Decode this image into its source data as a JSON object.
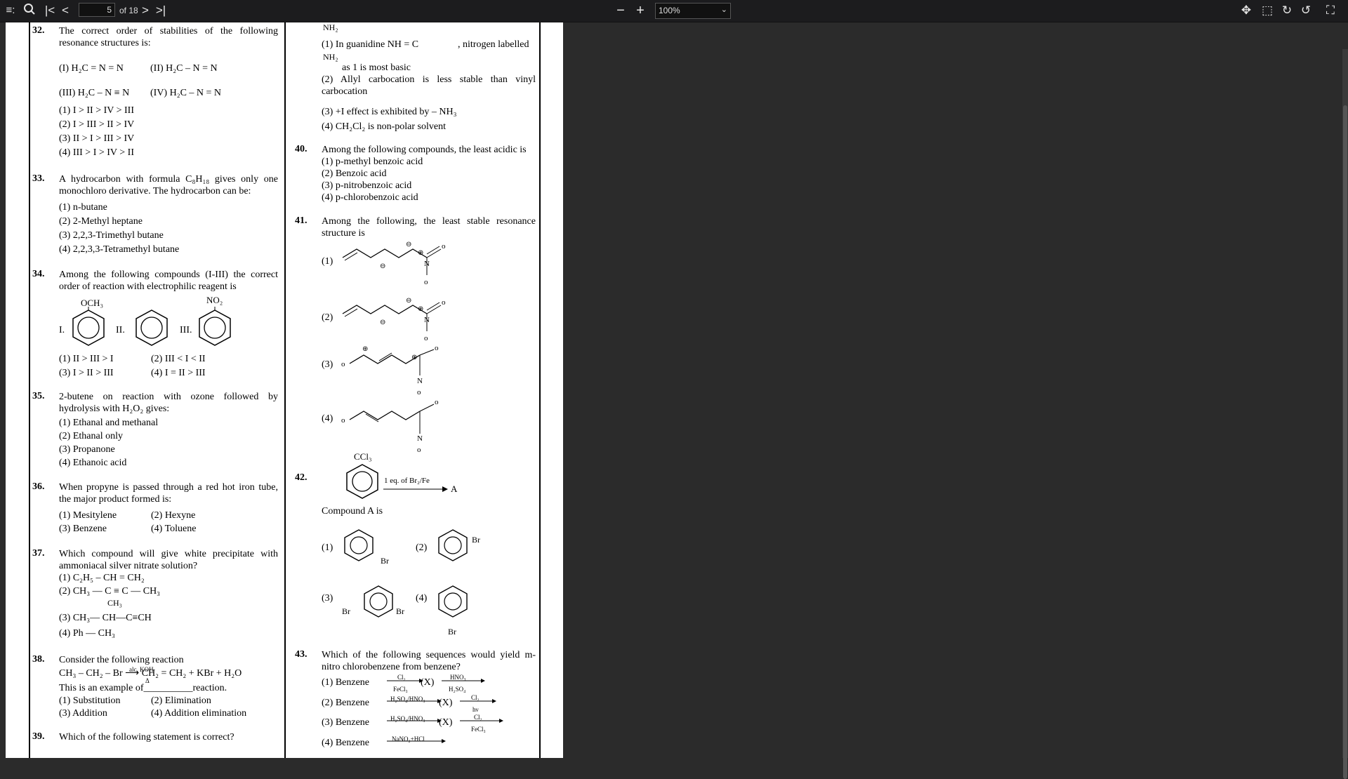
{
  "toolbar": {
    "page_current": "5",
    "page_total": "of 18",
    "zoom": "100%",
    "icons": [
      "sidebar-toggle-icon",
      "search-icon",
      "first-page-icon",
      "prev-page-icon",
      "next-page-icon",
      "last-page-icon",
      "zoom-out-icon",
      "zoom-in-icon",
      "pan-icon",
      "select-icon",
      "rotate-cw-icon",
      "rotate-ccw-icon",
      "fullscreen-icon"
    ]
  },
  "left": {
    "q32": {
      "num": "32.",
      "text": "The correct order of stabilities of the following resonance structures is:",
      "r1": "(I)  H₂C = N = N",
      "r2": "(II)  H₂C – N = N",
      "r3": "(III) H₂C – N ≡ N",
      "r4": "(IV) H₂C – N = N",
      "o1": "(1)  I > II > IV > III",
      "o2": "(2)  I > III > II > IV",
      "o3": "(3)  II > I > III > IV",
      "o4": "(4)  III > I > IV > II"
    },
    "q33": {
      "num": "33.",
      "text": "A hydrocarbon with formula C₈H₁₈ gives only one monochloro derivative. The hydrocarbon can be:",
      "o1": "(1)  n-butane",
      "o2": "(2)  2-Methyl heptane",
      "o3": "(3)  2,2,3-Trimethyl butane",
      "o4": "(4)  2,2,3,3-Tetramethyl butane"
    },
    "q34": {
      "num": "34.",
      "text": "Among the following compounds (I-III) the correct order of reaction with electrophilic reagent is",
      "l1": "I.",
      "l2": "II.",
      "l3": "III.",
      "s1": "OCH₃",
      "s3": "NO₂",
      "o1": "(1)  II > III > I",
      "o2": "(2)  III < I < II",
      "o3": "(3)  I > II > III",
      "o4": "(4)  I = II > III"
    },
    "q35": {
      "num": "35.",
      "text": "2-butene on reaction with ozone followed by hydrolysis with H₂O₂ gives:",
      "o1": "(1)  Ethanal and methanal",
      "o2": "(2)  Ethanal only",
      "o3": "(3)  Propanone",
      "o4": "(4)  Ethanoic acid"
    },
    "q36": {
      "num": "36.",
      "text": "When propyne is passed through a red hot iron tube, the major product formed is:",
      "o1": "(1)  Mesitylene",
      "o2": "(2)  Hexyne",
      "o3": "(3)  Benzene",
      "o4": "(4)  Toluene"
    },
    "q37": {
      "num": "37.",
      "text": "Which compound will give white precipitate with ammoniacal silver nitrate solution?",
      "o1": "(1)  C₂H₅ – CH = CH₂",
      "o2": "(2)  CH₃ — C ≡ C — CH₃",
      "o3_top": "CH₃",
      "o3": "(3)    CH₃— CH—C≡CH",
      "o4": "(4)  Ph — CH₃"
    },
    "q38": {
      "num": "38.",
      "text": "Consider the following reaction",
      "eq": "CH₃ – CH₂ – Br ⟶ CH₂ = CH₂ + KBr + H₂O",
      "eq_top": "alc. KOH",
      "eq_bot": "Δ",
      "text2": "This is an example of__________reaction.",
      "o1": "(1)  Substitution",
      "o2": "(2)  Elimination",
      "o3": "(3)  Addition",
      "o4": "(4)  Addition elimination"
    },
    "q39": {
      "num": "39.",
      "text": "Which of the following statement is correct?"
    }
  },
  "right": {
    "q39o": {
      "o1a": "(1)  In guanidine NH = C",
      "o1b": ", nitrogen labelled",
      "o1c": "as 1 is most basic",
      "nh2": "NH₂",
      "o2": "(2)  Allyl carbocation is less stable than vinyl carbocation",
      "o3": "(3)  +I effect is exhibited by – NH₃",
      "o4": "(4)  CH₂Cl₂ is non-polar solvent"
    },
    "q40": {
      "num": "40.",
      "text": "Among the following compounds, the least acidic is",
      "o1": "(1)  p-methyl benzoic acid",
      "o2": "(2)  Benzoic acid",
      "o3": "(3)  p-nitrobenzoic acid",
      "o4": "(4)  p-chlorobenzoic acid"
    },
    "q41": {
      "num": "41.",
      "text": "Among the following, the least stable resonance structure is",
      "o1": "(1)",
      "o2": "(2)",
      "o3": "(3)",
      "o4": "(4)"
    },
    "q42": {
      "num": "42.",
      "ccl3": "CCl₃",
      "reagent": "1 eq. of Br₂/Fe",
      "product": "A",
      "text": "Compound A is",
      "o1": "(1)",
      "o2": "(2)",
      "o3": "(3)",
      "o4": "(4)",
      "br": "Br"
    },
    "q43": {
      "num": "43.",
      "text": "Which of the following sequences would yield m-nitro chlorobenzene from benzene?",
      "o1": "(1)  Benzene",
      "o2": "(2)  Benzene",
      "o3": "(3)  Benzene",
      "o4": "(4)  Benzene",
      "x": "(X)",
      "r1a": "Cl₂",
      "r1b": "FeCl₃",
      "r1c": "HNO₃",
      "r1d": "H₂SO₄",
      "r2a": "H₂SO₄/HNO₃",
      "r2c": "Cl₂",
      "r2d": "hν",
      "r3a": "H₂SO₄/HNO₃",
      "r3c": "Cl₂",
      "r3d": "FeCl₃",
      "r4a": "NaNO₂+HCl"
    }
  }
}
